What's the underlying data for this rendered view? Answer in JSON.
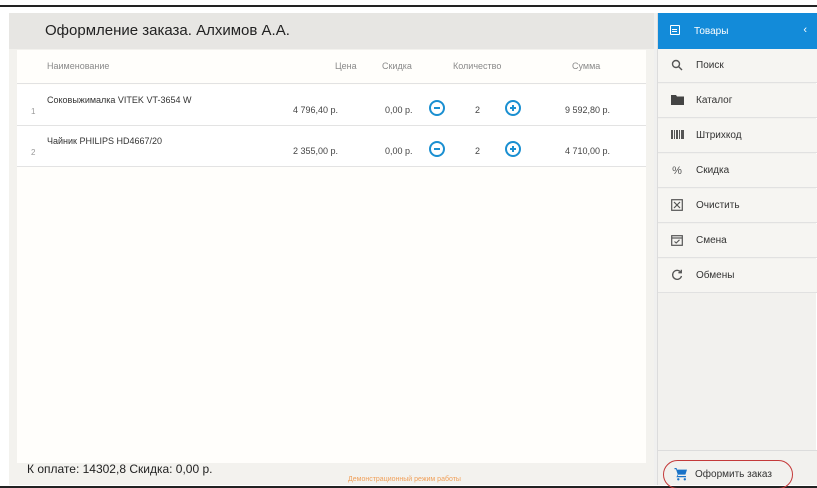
{
  "header": {
    "title": "Оформление заказа. Алхимов А.А."
  },
  "table": {
    "columns": {
      "name": "Наименование",
      "price": "Цена",
      "discount": "Скидка",
      "quantity": "Количество",
      "sum": "Сумма"
    },
    "rows": [
      {
        "num": "1",
        "name": "Соковыжималка VITEK VT-3654 W",
        "price": "4 796,40 р.",
        "discount": "0,00 р.",
        "quantity": "2",
        "sum": "9 592,80 р."
      },
      {
        "num": "2",
        "name": "Чайник PHILIPS HD4667/20",
        "price": "2 355,00 р.",
        "discount": "0,00 р.",
        "quantity": "2",
        "sum": "4 710,00 р."
      }
    ]
  },
  "footer": {
    "total": "К оплате: 14302,8  Скидка: 0,00 р.",
    "demo": "Демонстрационный режим работы"
  },
  "sidebar": {
    "header": {
      "label": "Товары",
      "icon": "box-icon"
    },
    "items": [
      {
        "label": "Поиск",
        "icon": "search-icon"
      },
      {
        "label": "Каталог",
        "icon": "folder-icon"
      },
      {
        "label": "Штрихкод",
        "icon": "barcode-icon"
      },
      {
        "label": "Скидка",
        "icon": "percent-icon"
      },
      {
        "label": "Очистить",
        "icon": "clear-icon"
      },
      {
        "label": "Смена",
        "icon": "calendar-icon"
      },
      {
        "label": "Обмены",
        "icon": "refresh-icon"
      }
    ],
    "order_button": "Оформить заказ"
  },
  "colors": {
    "accent": "#138bd9",
    "order_outline": "#c43a3a",
    "demo_text": "#f0a05a"
  }
}
